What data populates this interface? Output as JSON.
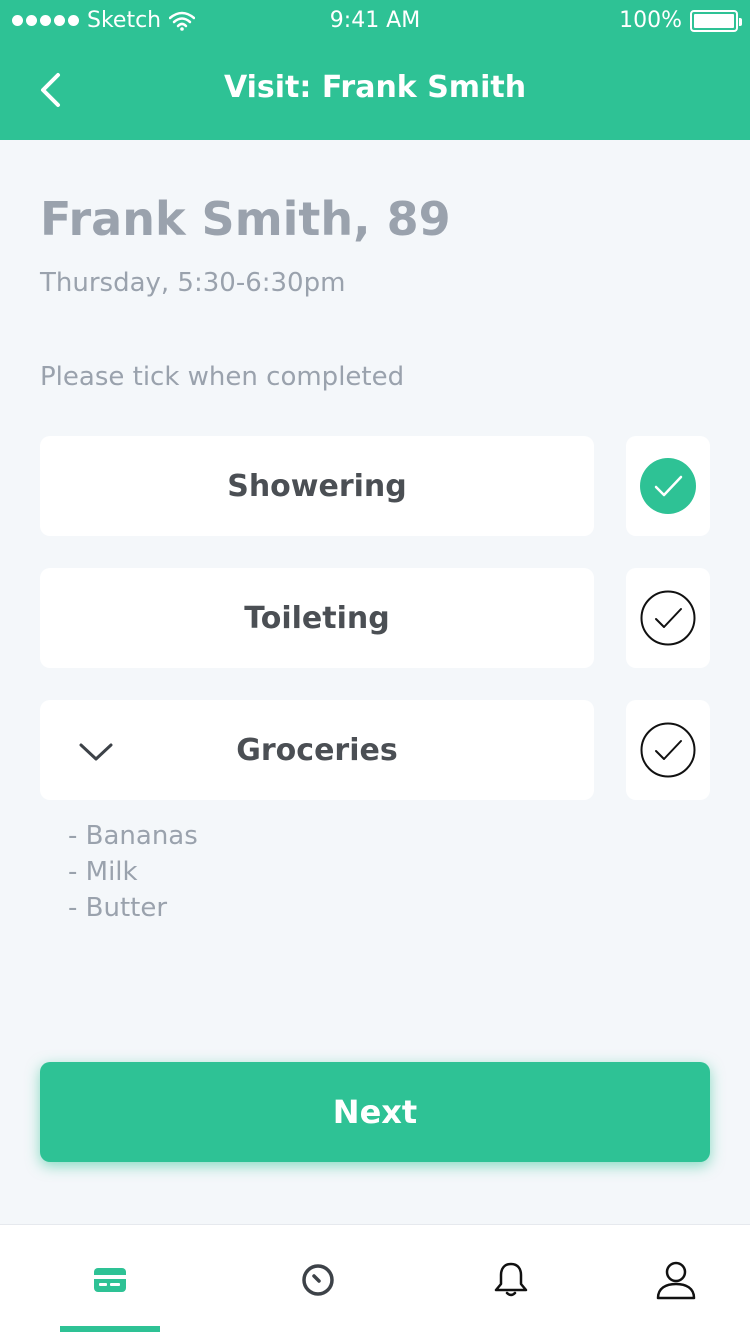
{
  "status_bar": {
    "carrier": "Sketch",
    "time": "9:41 AM",
    "battery": "100%"
  },
  "header": {
    "title": "Visit: Frank Smith",
    "back_icon": "chevron-left-icon"
  },
  "patient": {
    "name_age": "Frank Smith, 89",
    "visit_time": "Thursday, 5:30-6:30pm"
  },
  "instruction": "Please tick when completed",
  "tasks": [
    {
      "label": "Showering",
      "completed": true
    },
    {
      "label": "Toileting",
      "completed": false
    },
    {
      "label": "Groceries",
      "completed": false,
      "expanded": true
    }
  ],
  "groceries": [
    "- Bananas",
    "- Milk",
    "- Butter"
  ],
  "next_button": "Next",
  "tab_bar": {
    "tabs": [
      "card-icon",
      "clock-icon",
      "bell-icon",
      "profile-icon"
    ],
    "active_index": 0
  },
  "colors": {
    "primary": "#2ec295",
    "background": "#f4f7fa",
    "muted_text": "#9aa2ad",
    "dark_text": "#4b4f54"
  }
}
